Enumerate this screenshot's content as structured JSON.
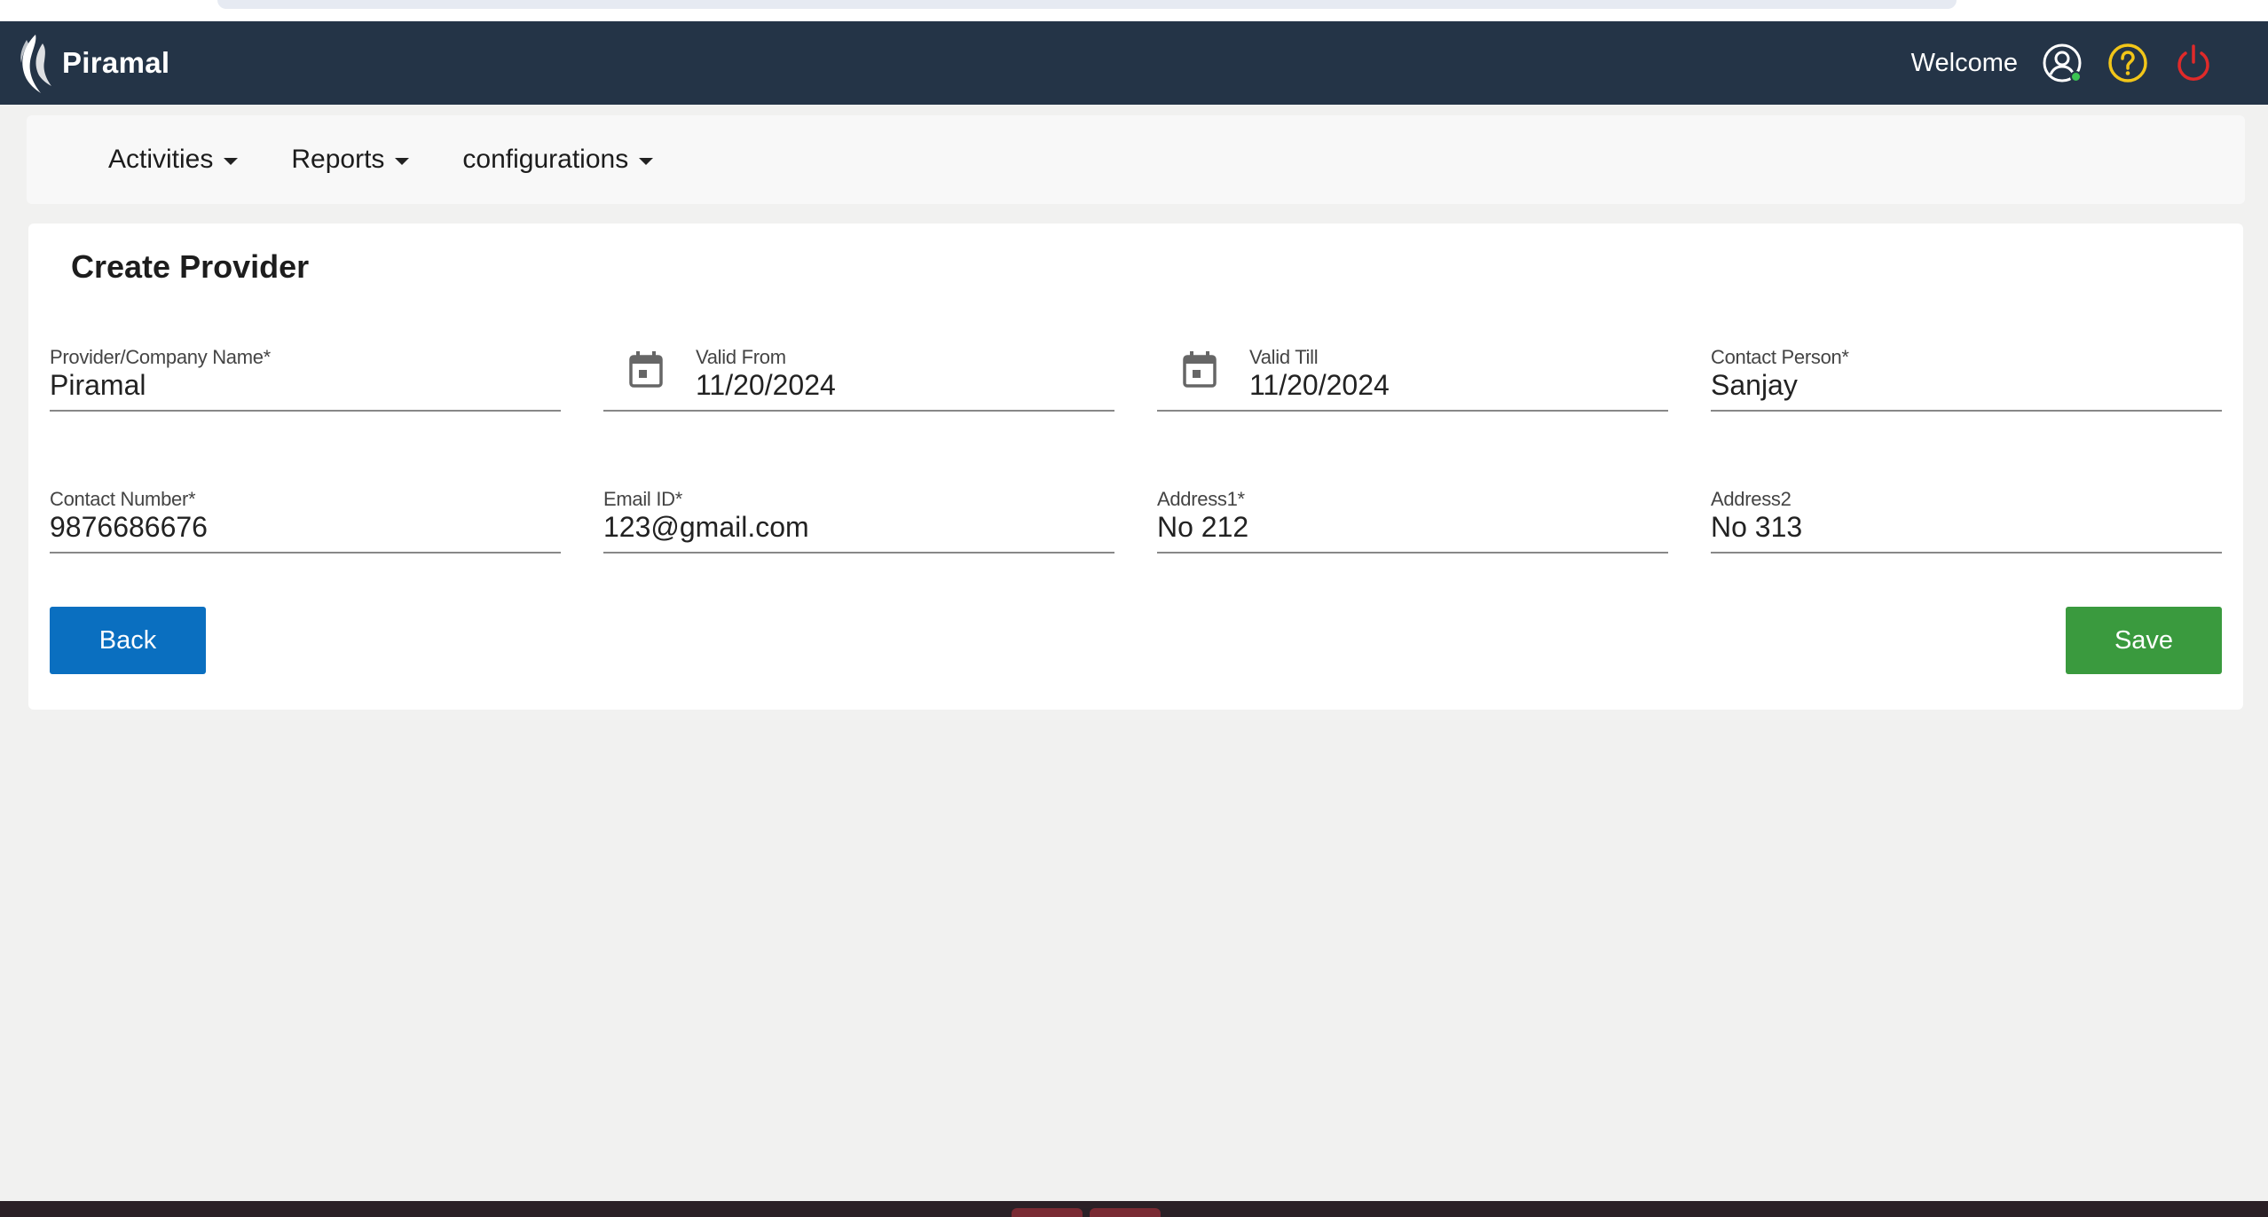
{
  "header": {
    "logo_text": "Piramal",
    "welcome": "Welcome",
    "icons": [
      "user-circle-icon",
      "help-circle-icon",
      "power-icon"
    ],
    "colors": {
      "bar": "#243447",
      "help": "#f2c619",
      "power": "#e02a2a",
      "online": "#3cc453"
    }
  },
  "nav": {
    "items": [
      {
        "label": "Activities"
      },
      {
        "label": "Reports"
      },
      {
        "label": "configurations"
      }
    ]
  },
  "form": {
    "title": "Create Provider",
    "fields": [
      {
        "label": "Provider/Company Name*",
        "value": "Piramal"
      },
      {
        "label": "Valid From",
        "value": "11/20/2024",
        "icon": "calendar-icon"
      },
      {
        "label": "Valid Till",
        "value": "11/20/2024",
        "icon": "calendar-icon"
      },
      {
        "label": "Contact Person*",
        "value": "Sanjay"
      },
      {
        "label": "Contact Number*",
        "value": "9876686676"
      },
      {
        "label": "Email ID*",
        "value": "123@gmail.com"
      },
      {
        "label": "Address1*",
        "value": "No 212"
      },
      {
        "label": "Address2",
        "value": "No 313"
      }
    ],
    "back_label": "Back",
    "save_label": "Save",
    "colors": {
      "back": "#0a6fc0",
      "save": "#3a9a3e"
    }
  }
}
